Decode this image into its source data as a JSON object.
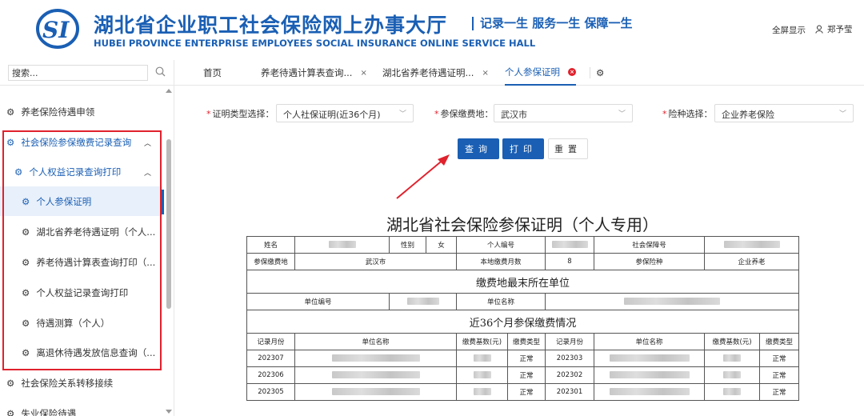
{
  "header": {
    "title_cn": "湖北省企业职工社会保险网上办事大厅",
    "title_en": "HUBEI PROVINCE ENTERPRISE EMPLOYEES SOCIAL INSURANCE ONLINE SERVICE HALL",
    "slogan": "记录一生 服务一生 保障一生",
    "fullscreen": "全屏显示",
    "user_name": "郑予莹",
    "brand_color": "#1a5fb4"
  },
  "sidebar": {
    "search_placeholder": "搜索...",
    "items": [
      {
        "label": "养老保险待遇申领"
      },
      {
        "label": "社会保险参保缴费记录查询"
      },
      {
        "label": "个人权益记录查询打印"
      },
      {
        "label": "个人参保证明"
      },
      {
        "label": "湖北省养老待遇证明（个人..."
      },
      {
        "label": "养老待遇计算表查询打印（..."
      },
      {
        "label": "个人权益记录查询打印"
      },
      {
        "label": "待遇测算（个人）"
      },
      {
        "label": "离退休待遇发放信息查询（..."
      },
      {
        "label": "社会保险关系转移接续"
      },
      {
        "label": "失业保险待遇"
      }
    ]
  },
  "tabs": [
    {
      "label": "首页"
    },
    {
      "label": "养老待遇计算表查询..."
    },
    {
      "label": "湖北省养老待遇证明..."
    },
    {
      "label": "个人参保证明"
    }
  ],
  "form": {
    "type_label": "证明类型选择：",
    "type_value": "个人社保证明(近36个月)",
    "place_label": "参保缴费地：",
    "place_value": "武汉市",
    "insurance_label": "险种选择：",
    "insurance_value": "企业养老保险",
    "query_btn": "查询",
    "print_btn": "打印",
    "reset_btn": "重置"
  },
  "certificate": {
    "title": "湖北省社会保险参保证明（个人专用）",
    "name_label": "姓名",
    "gender_label": "性别",
    "gender_value": "女",
    "personal_no_label": "个人编号",
    "ssn_label": "社会保障号",
    "place_label": "参保缴费地",
    "place_value": "武汉市",
    "months_label": "本地缴费月数",
    "months_value": "8",
    "insurance_label": "参保险种",
    "insurance_value": "企业养老",
    "section1": "缴费地最末所在单位",
    "unit_no_label": "单位编号",
    "unit_name_label": "单位名称",
    "section2": "近36个月参保缴费情况",
    "col_month": "记录月份",
    "col_unit": "单位名称",
    "col_base": "缴费基数(元)",
    "col_type": "缴费类型",
    "rows": [
      {
        "m1": "202307",
        "t1": "正常",
        "m2": "202303",
        "t2": "正常"
      },
      {
        "m1": "202306",
        "t1": "正常",
        "m2": "202302",
        "t2": "正常"
      },
      {
        "m1": "202305",
        "t1": "正常",
        "m2": "202301",
        "t2": "正常"
      }
    ]
  }
}
